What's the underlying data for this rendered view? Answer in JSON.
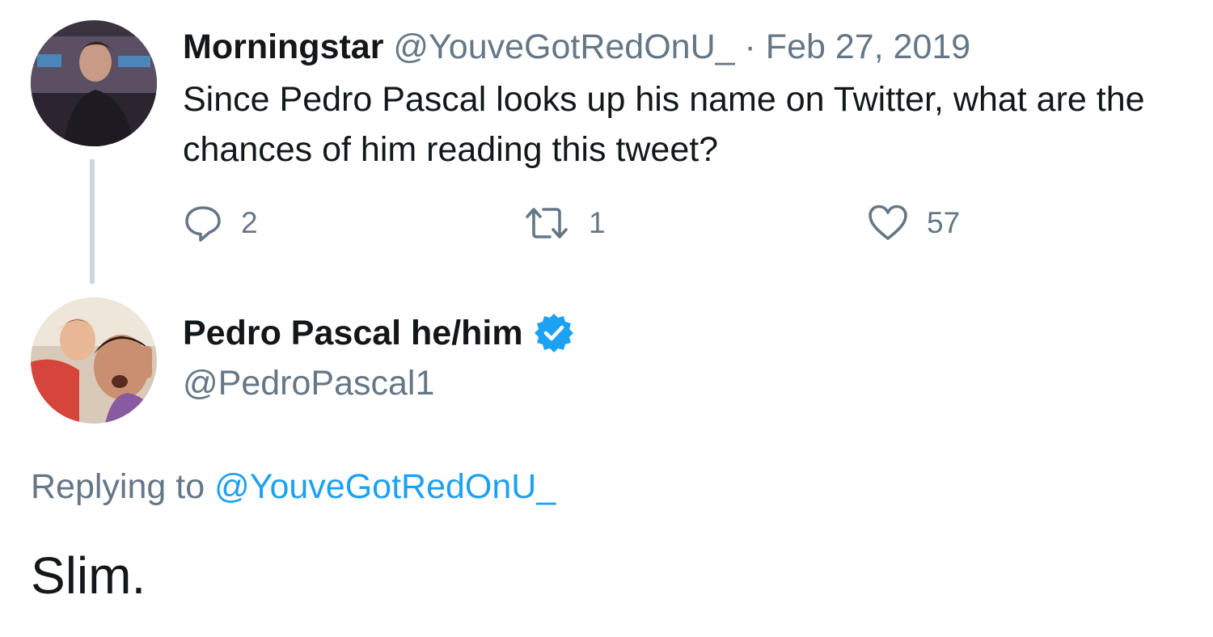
{
  "original_tweet": {
    "display_name": "Morningstar",
    "handle": "@YouveGotRedOnU_",
    "separator": "·",
    "date": "Feb 27, 2019",
    "text": "Since Pedro Pascal looks up his name on Twitter, what are the chances of him reading this tweet?",
    "actions": {
      "reply": {
        "icon": "reply-icon",
        "count": "2"
      },
      "retweet": {
        "icon": "retweet-icon",
        "count": "1"
      },
      "like": {
        "icon": "heart-icon",
        "count": "57"
      }
    }
  },
  "reply_tweet": {
    "display_name": "Pedro Pascal he/him",
    "verified": true,
    "verified_icon": "verified-badge-icon",
    "handle": "@PedroPascal1",
    "replying_to_label": "Replying to",
    "replying_to_handle": "@YouveGotRedOnU_",
    "text": "Slim."
  },
  "colors": {
    "text_primary": "#14171a",
    "text_secondary": "#657786",
    "accent": "#1da1f2",
    "thread_line": "#ccd6dd"
  }
}
